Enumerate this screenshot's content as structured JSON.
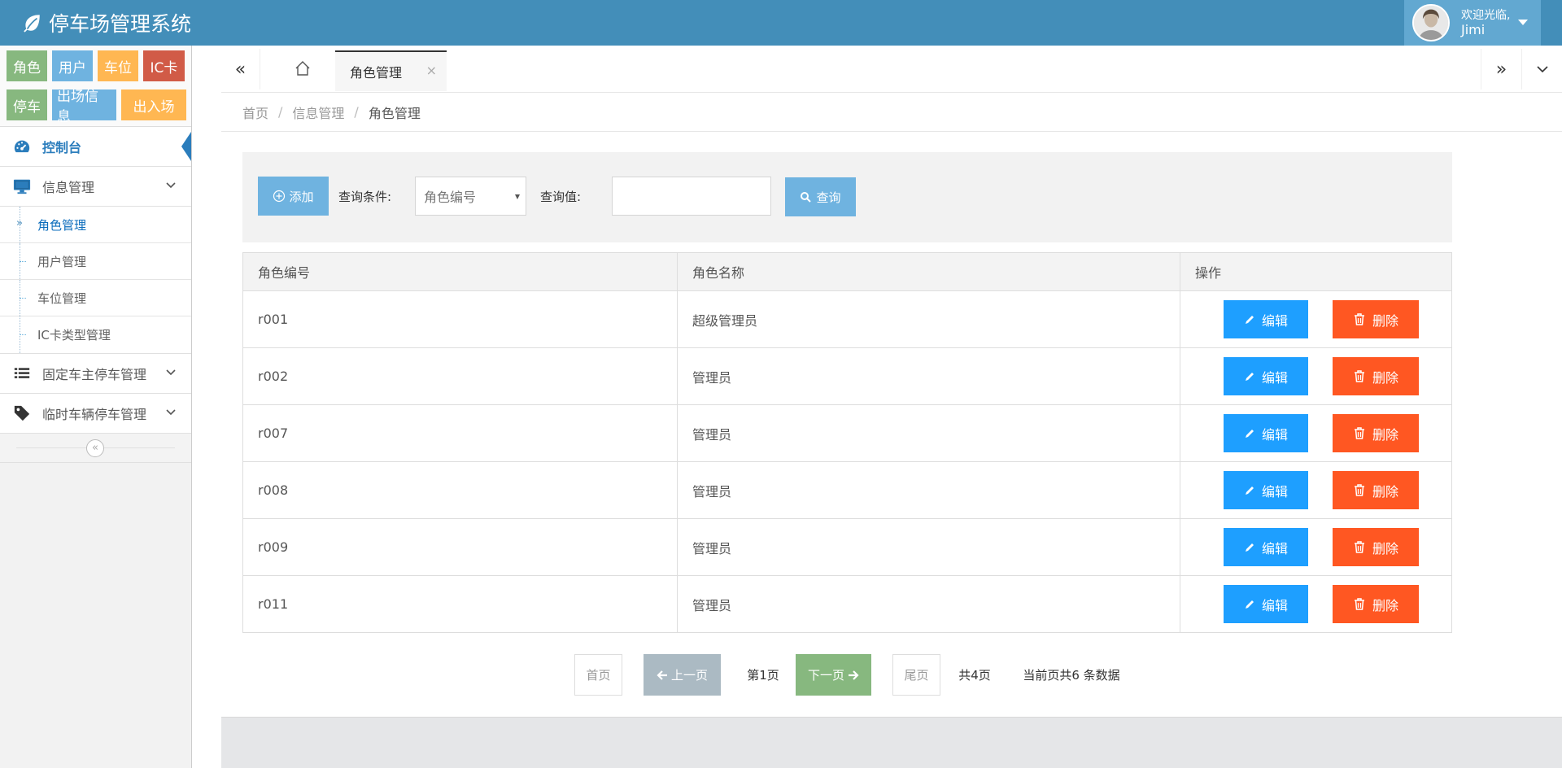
{
  "app": {
    "title": "停车场管理系统",
    "brand_color": "#438eb9"
  },
  "user": {
    "greeting": "欢迎光临,",
    "name": "Jimi"
  },
  "shortcuts": {
    "row1": [
      {
        "label": "角色",
        "color": "green"
      },
      {
        "label": "用户",
        "color": "blue"
      },
      {
        "label": "车位",
        "color": "orange"
      },
      {
        "label": "IC卡",
        "color": "red"
      }
    ],
    "row2": [
      {
        "label": "停车",
        "color": "green"
      },
      {
        "label": "出场信息",
        "color": "blue"
      },
      {
        "label": "出入场",
        "color": "orange"
      }
    ]
  },
  "sidebar": {
    "dashboard": "控制台",
    "info_mgmt": "信息管理",
    "sub_items": [
      "角色管理",
      "用户管理",
      "车位管理",
      "IC卡类型管理"
    ],
    "fixed_parking": "固定车主停车管理",
    "temp_parking": "临时车辆停车管理"
  },
  "tabs": {
    "active": "角色管理"
  },
  "breadcrumb": {
    "home": "首页",
    "section": "信息管理",
    "current": "角色管理"
  },
  "toolbar": {
    "add_label": "添加",
    "condition_label": "查询条件:",
    "condition_value": "角色编号",
    "value_label": "查询值:",
    "value_input": "",
    "search_label": "查询"
  },
  "table": {
    "headers": [
      "角色编号",
      "角色名称",
      "操作"
    ],
    "edit_label": "编辑",
    "delete_label": "删除",
    "rows": [
      {
        "id": "r001",
        "name": "超级管理员"
      },
      {
        "id": "r002",
        "name": "管理员"
      },
      {
        "id": "r007",
        "name": "管理员"
      },
      {
        "id": "r008",
        "name": "管理员"
      },
      {
        "id": "r009",
        "name": "管理员"
      },
      {
        "id": "r011",
        "name": "管理员"
      }
    ]
  },
  "pager": {
    "first": "首页",
    "prev": "上一页",
    "current": "第1页",
    "next": "下一页",
    "last": "尾页",
    "total": "共4页",
    "info": "当前页共6 条数据"
  }
}
